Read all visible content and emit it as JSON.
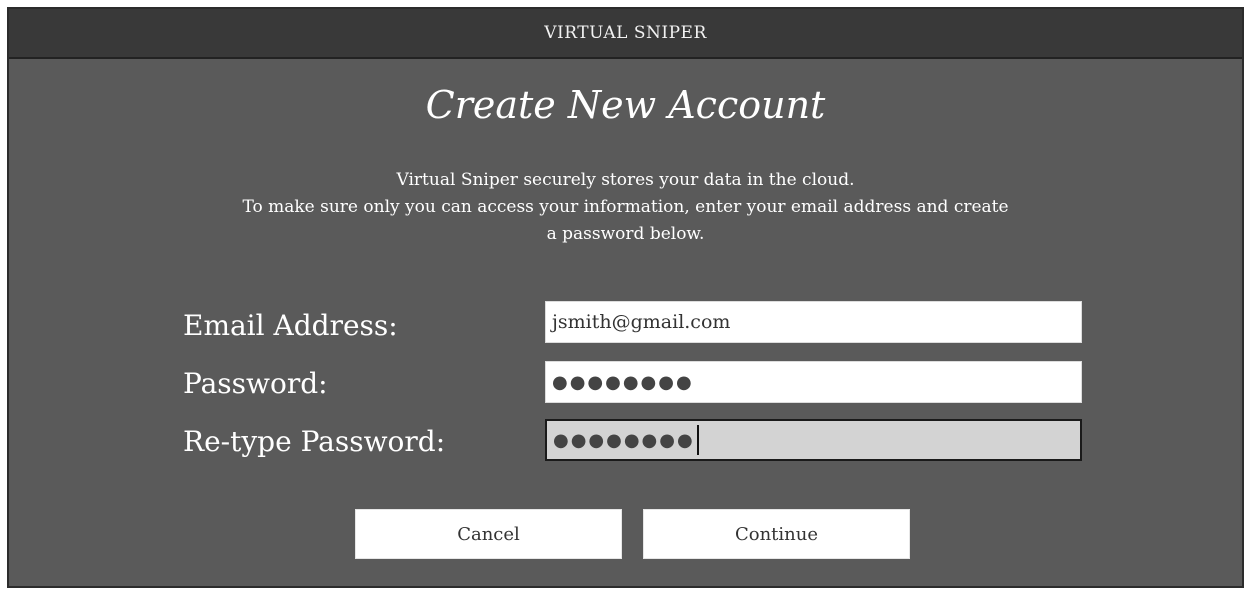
{
  "window": {
    "title": "VIRTUAL SNIPER"
  },
  "dialog": {
    "heading": "Create New Account",
    "description_lines": [
      "Virtual Sniper securely stores your data in the cloud.",
      "To make sure only you can access your information, enter your email address and create",
      "a password below."
    ]
  },
  "form": {
    "email_label": "Email Address:",
    "email_value": "jsmith@gmail.com",
    "password_label": "Password:",
    "password_value": "●●●●●●●●",
    "retype_label": "Re-type Password:",
    "retype_value": "●●●●●●●●"
  },
  "buttons": {
    "cancel_label": "Cancel",
    "continue_label": "Continue"
  },
  "colors": {
    "window_background": "#5a5a5a",
    "titlebar_background": "#393939",
    "active_field_background": "#d3d3d3",
    "text": "#ffffff"
  }
}
